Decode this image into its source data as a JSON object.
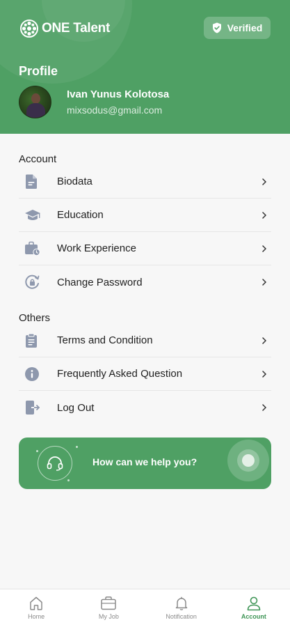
{
  "header": {
    "logo_text": "ONE Talent",
    "verified_label": "Verified",
    "profile_title": "Profile",
    "user_name": "Ivan Yunus Kolotosa",
    "user_email": "mixsodus@gmail.com"
  },
  "account": {
    "title": "Account",
    "items": [
      {
        "label": "Biodata",
        "icon": "document-icon"
      },
      {
        "label": "Education",
        "icon": "graduation-cap-icon"
      },
      {
        "label": "Work Experience",
        "icon": "briefcase-clock-icon"
      },
      {
        "label": "Change Password",
        "icon": "password-reset-icon"
      }
    ]
  },
  "others": {
    "title": "Others",
    "items": [
      {
        "label": "Terms and Condition",
        "icon": "clipboard-icon"
      },
      {
        "label": "Frequently Asked Question",
        "icon": "info-icon"
      },
      {
        "label": "Log Out",
        "icon": "logout-icon"
      }
    ]
  },
  "help": {
    "label": "How can we help you?"
  },
  "tabs": [
    {
      "label": "Home",
      "icon": "home-icon",
      "active": false
    },
    {
      "label": "My Job",
      "icon": "briefcase-icon",
      "active": false
    },
    {
      "label": "Notification",
      "icon": "bell-icon",
      "active": false
    },
    {
      "label": "Account",
      "icon": "user-icon",
      "active": true
    }
  ],
  "colors": {
    "brand_green": "#4fa064",
    "active_tab": "#3e9556",
    "icon_gray": "#8e98ad"
  }
}
